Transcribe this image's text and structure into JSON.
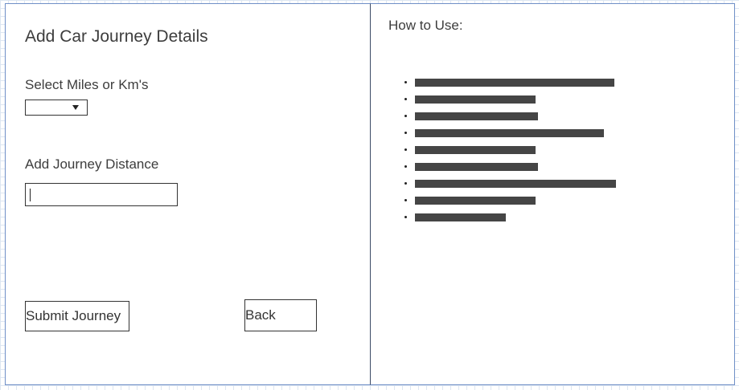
{
  "form": {
    "title": "Add Car Journey Details",
    "units_label": "Select Miles or Km's",
    "units_selected": "",
    "distance_label": "Add Journey Distance",
    "distance_value": "",
    "submit_label": "Submit Journey",
    "back_label": "Back"
  },
  "help": {
    "title": "How to Use:",
    "items": [
      {
        "fill": 0.99
      },
      {
        "fill": 0.6
      },
      {
        "fill": 0.61
      },
      {
        "fill": 0.94
      },
      {
        "fill": 0.6
      },
      {
        "fill": 0.61
      },
      {
        "fill": 1.0
      },
      {
        "fill": 0.6
      },
      {
        "fill": 0.45
      }
    ]
  }
}
